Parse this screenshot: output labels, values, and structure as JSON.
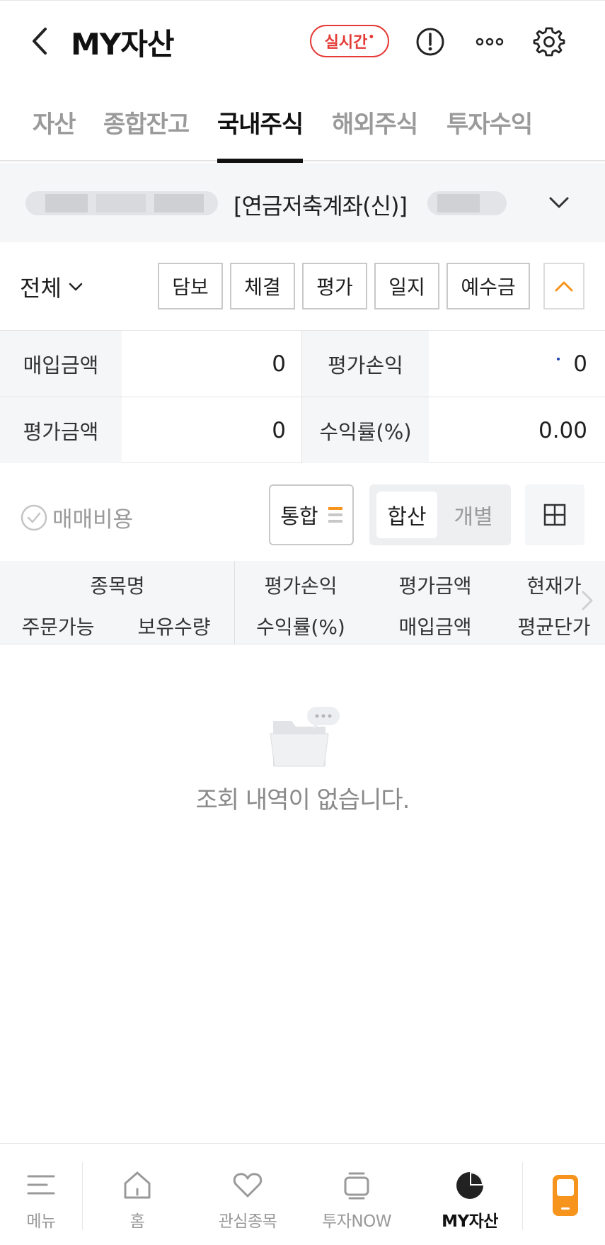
{
  "header": {
    "title": "MY자산",
    "realtime_badge": "실시간",
    "realtime_dot": "•",
    "icons": [
      "back-icon",
      "info-icon",
      "more-icon",
      "gear-icon"
    ]
  },
  "tabs": [
    {
      "label": "자산"
    },
    {
      "label": "종합잔고"
    },
    {
      "label": "국내주식",
      "active": true
    },
    {
      "label": "해외주식"
    },
    {
      "label": "투자수익"
    }
  ],
  "account": {
    "name": "[연금저축계좌(신)]"
  },
  "filter": {
    "selected": "전체",
    "buttons": [
      "담보",
      "체결",
      "평가",
      "일지",
      "예수금"
    ]
  },
  "summary": {
    "rows": [
      {
        "label_left": "매입금액",
        "value_left": "0",
        "label_right": "평가손익",
        "value_right": "0"
      },
      {
        "label_left": "평가금액",
        "value_left": "0",
        "label_right": "수익률(%)",
        "value_right": "0.00"
      }
    ]
  },
  "toolbar": {
    "fee_label": "매매비용",
    "unified_label": "통합",
    "segment_on": "합산",
    "segment_off": "개별"
  },
  "table": {
    "row1": [
      "종목명",
      "평가손익",
      "평가금액",
      "현재가"
    ],
    "row2": [
      "주문가능",
      "보유수량",
      "수익률(%)",
      "매입금액",
      "평균단가"
    ]
  },
  "empty_message": "조회 내역이 없습니다.",
  "bottom_nav": [
    {
      "label": "메뉴",
      "icon": "menu-icon"
    },
    {
      "label": "홈",
      "icon": "home-icon"
    },
    {
      "label": "관심종목",
      "icon": "heart-icon"
    },
    {
      "label": "투자NOW",
      "icon": "tv-icon"
    },
    {
      "label": "MY자산",
      "icon": "pie-chart-icon",
      "active": true
    }
  ],
  "colors": {
    "accent_orange": "#f7941d",
    "badge_red": "#e53935",
    "panel_gray": "#f5f6f8"
  }
}
